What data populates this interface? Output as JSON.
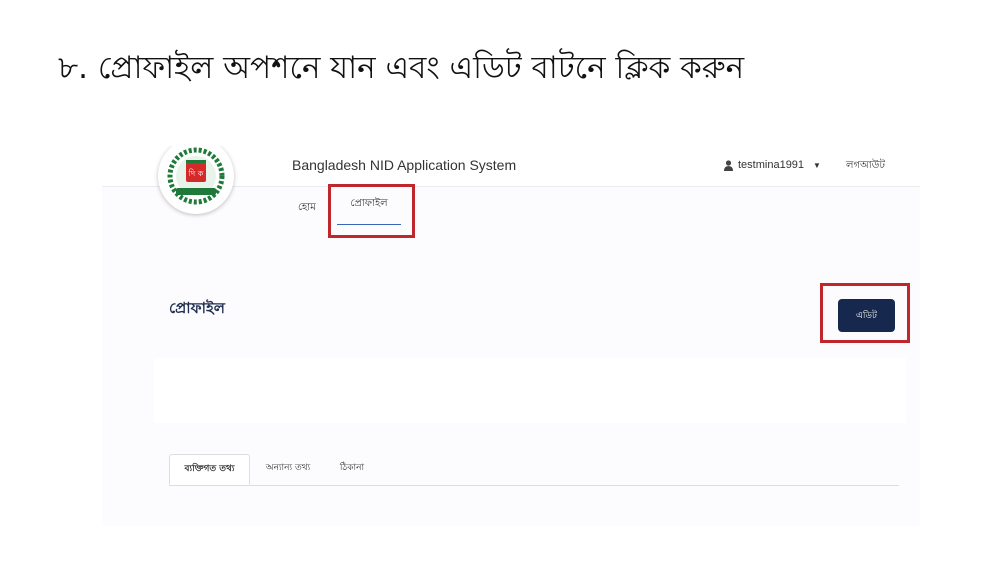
{
  "slide": {
    "title": "৮. প্রোফাইল অপশনে যান এবং এডিট বাটনে ক্লিক করুন"
  },
  "header": {
    "logo_icon": "bangladesh-government-emblem-icon",
    "app_title": "Bangladesh NID Application System",
    "user_icon": "person-icon",
    "username": "testmina1991",
    "caret_icon": "caret-down-icon",
    "logout_label": "লগআউট"
  },
  "nav": {
    "items": [
      {
        "label": "হোম",
        "active": false
      },
      {
        "label": "প্রোফাইল",
        "active": true
      }
    ]
  },
  "page": {
    "heading": "প্রোফাইল",
    "edit_label": "এডিট"
  },
  "tabs": [
    {
      "label": "ব্যক্তিগত তথ্য",
      "active": true
    },
    {
      "label": "অন্যান্য তথ্য",
      "active": false
    },
    {
      "label": "ঠিকানা",
      "active": false
    }
  ],
  "colors": {
    "highlight": "#c0272d",
    "primary_button": "#16284d",
    "heading": "#1e2d4f",
    "nav_underline": "#3a66b8"
  }
}
